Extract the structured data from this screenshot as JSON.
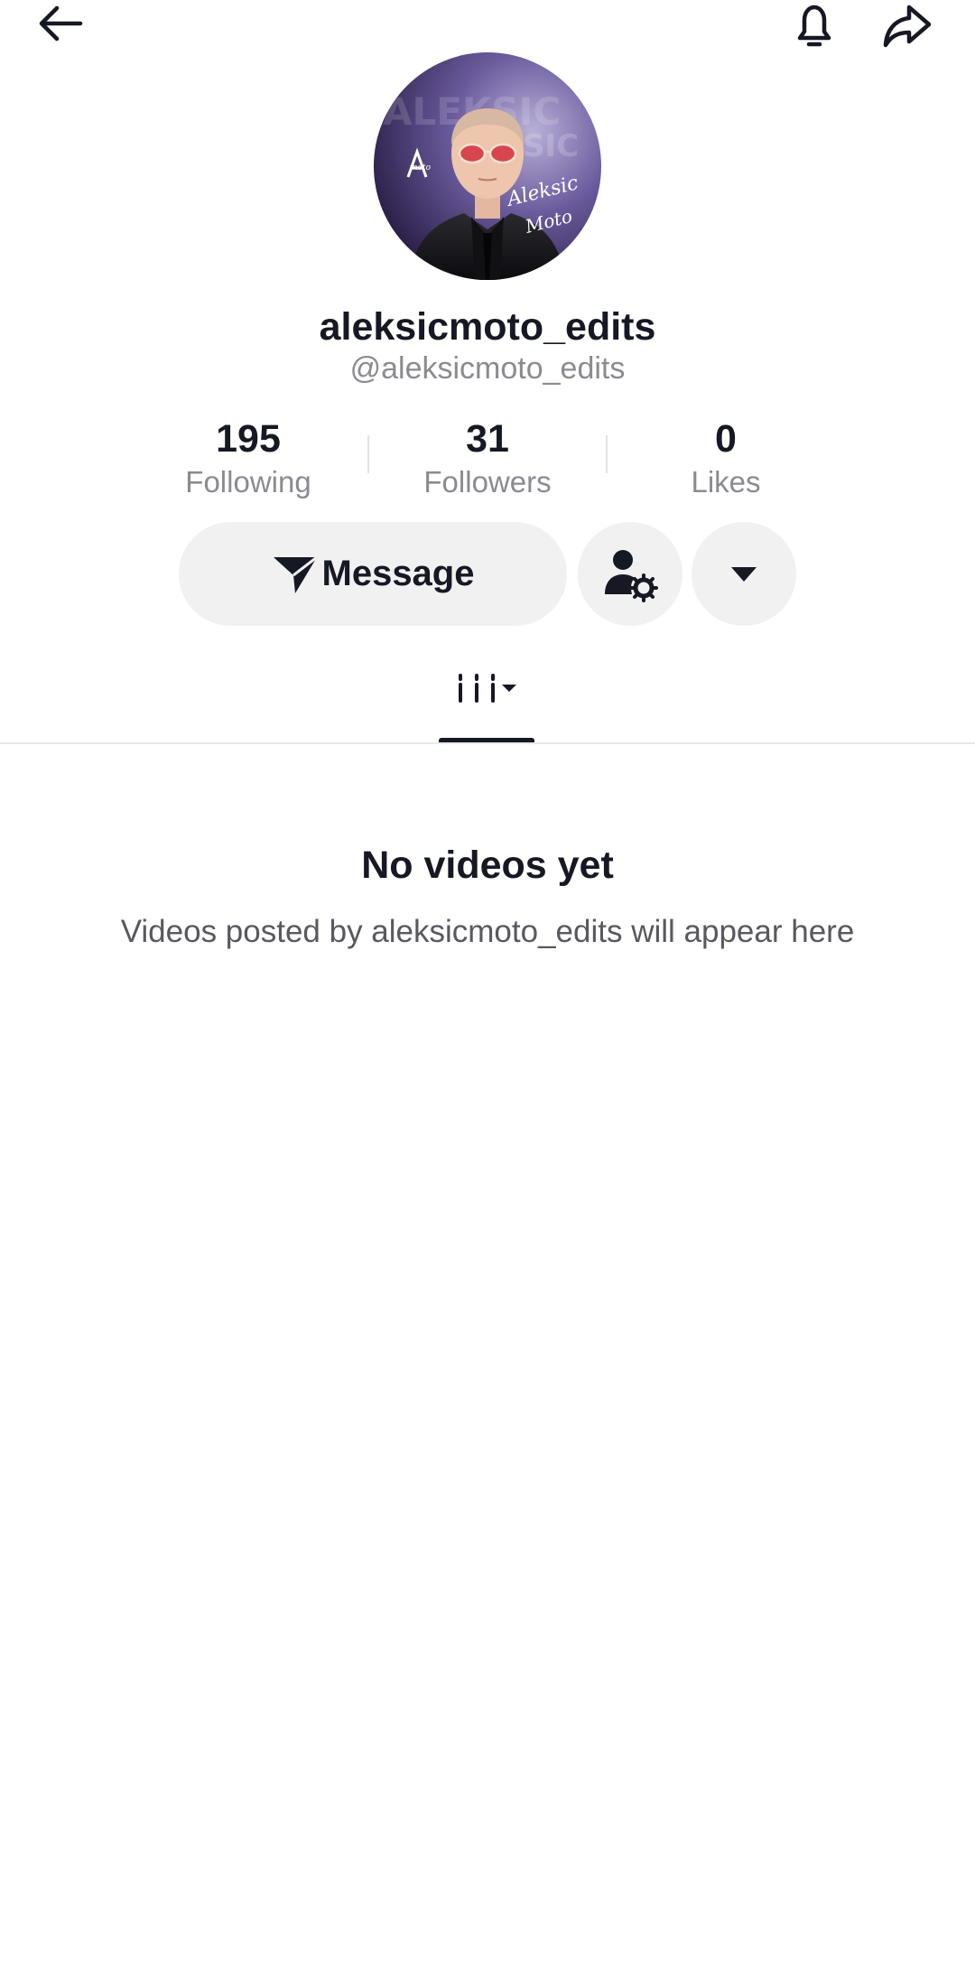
{
  "header": {
    "back_icon": "back-arrow-icon",
    "notification_icon": "bell-icon",
    "share_icon": "share-arrow-icon"
  },
  "profile": {
    "avatar_text": "Aleksic Moto",
    "display_name": "aleksicmoto_edits",
    "username": "@aleksicmoto_edits"
  },
  "stats": {
    "following": {
      "value": "195",
      "label": "Following"
    },
    "followers": {
      "value": "31",
      "label": "Followers"
    },
    "likes": {
      "value": "0",
      "label": "Likes"
    }
  },
  "actions": {
    "message_label": "Message",
    "message_icon": "send-icon",
    "friends_icon": "user-settings-icon",
    "more_icon": "caret-down-icon"
  },
  "tabs": [
    {
      "icon": "video-grid-icon",
      "selected": true
    }
  ],
  "empty_state": {
    "title": "No videos yet",
    "description": "Videos posted by aleksicmoto_edits will appear here"
  },
  "colors": {
    "text_primary": "#161823",
    "text_secondary": "#8a8b91",
    "button_bg": "#f1f1f2"
  }
}
